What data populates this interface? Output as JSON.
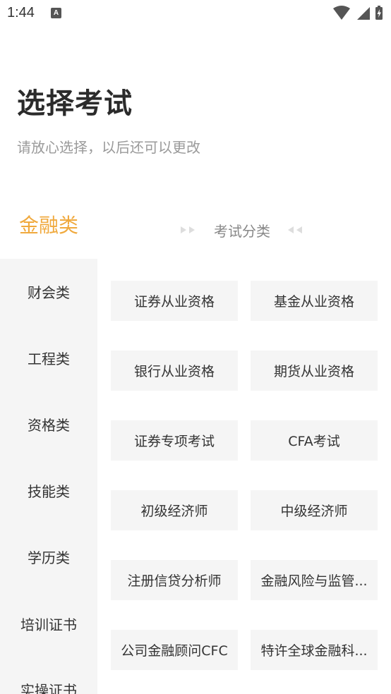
{
  "status_bar": {
    "time": "1:44",
    "notification_icon": "A"
  },
  "header": {
    "title": "选择考试",
    "subtitle": "请放心选择，以后还可以更改"
  },
  "current_category": "金融类",
  "section_label": "考试分类",
  "colors": {
    "accent": "#f0a93d",
    "sidebar_bg": "#f5f5f5",
    "card_bg": "#f5f5f5"
  },
  "sidebar": {
    "items": [
      {
        "label": "财会类"
      },
      {
        "label": "工程类"
      },
      {
        "label": "资格类"
      },
      {
        "label": "技能类"
      },
      {
        "label": "学历类"
      },
      {
        "label": "培训证书"
      },
      {
        "label": "实操证书"
      }
    ]
  },
  "exams": [
    {
      "label": "证券从业资格"
    },
    {
      "label": "基金从业资格"
    },
    {
      "label": "银行从业资格"
    },
    {
      "label": "期货从业资格"
    },
    {
      "label": "证券专项考试"
    },
    {
      "label": "CFA考试"
    },
    {
      "label": "初级经济师"
    },
    {
      "label": "中级经济师"
    },
    {
      "label": "注册信贷分析师"
    },
    {
      "label": "金融风险与监管..."
    },
    {
      "label": "公司金融顾问CFC"
    },
    {
      "label": "特许全球金融科..."
    }
  ]
}
